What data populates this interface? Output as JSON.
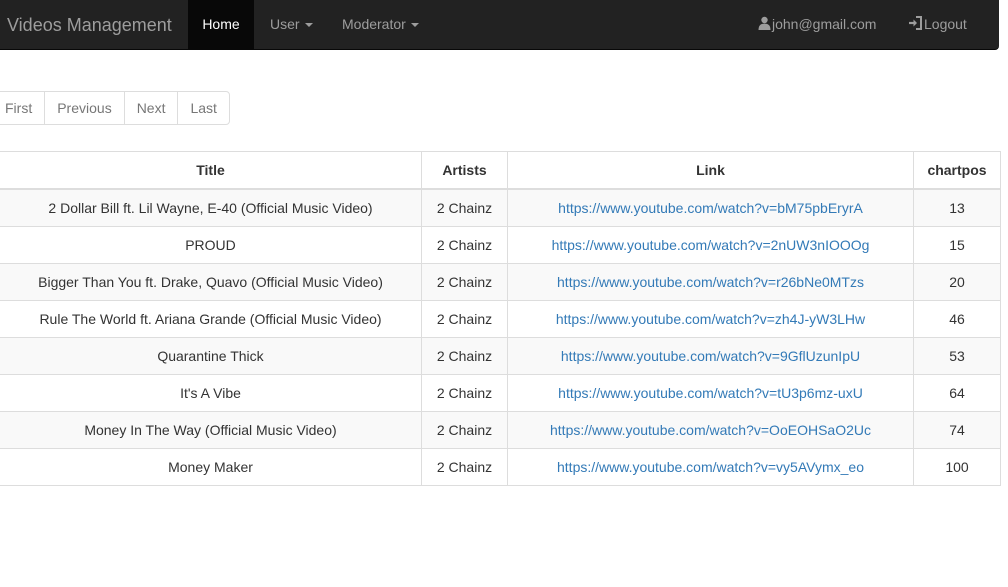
{
  "navbar": {
    "brand": "Videos Management",
    "items": [
      {
        "label": "Home"
      },
      {
        "label": "User"
      },
      {
        "label": "Moderator"
      }
    ],
    "user_email": "john@gmail.com",
    "logout_label": "Logout"
  },
  "pagination": [
    "First",
    "Previous",
    "Next",
    "Last"
  ],
  "table": {
    "headers": [
      "Title",
      "Artists",
      "Link",
      "chartpos"
    ],
    "rows": [
      [
        "2 Dollar Bill ft. Lil Wayne, E-40 (Official Music Video)",
        "2 Chainz",
        "https://www.youtube.com/watch?v=bM75pbEryrA",
        "13"
      ],
      [
        "PROUD",
        "2 Chainz",
        "https://www.youtube.com/watch?v=2nUW3nIOOOg",
        "15"
      ],
      [
        "Bigger Than You ft. Drake, Quavo (Official Music Video)",
        "2 Chainz",
        "https://www.youtube.com/watch?v=r26bNe0MTzs",
        "20"
      ],
      [
        "Rule The World ft. Ariana Grande (Official Music Video)",
        "2 Chainz",
        "https://www.youtube.com/watch?v=zh4J-yW3LHw",
        "46"
      ],
      [
        "Quarantine Thick",
        "2 Chainz",
        "https://www.youtube.com/watch?v=9GflUzunIpU",
        "53"
      ],
      [
        "It's A Vibe",
        "2 Chainz",
        "https://www.youtube.com/watch?v=tU3p6mz-uxU",
        "64"
      ],
      [
        "Money In The Way (Official Music Video)",
        "2 Chainz",
        "https://www.youtube.com/watch?v=OoEOHSaO2Uc",
        "74"
      ],
      [
        "Money Maker",
        "2 Chainz",
        "https://www.youtube.com/watch?v=vy5AVymx_eo",
        "100"
      ]
    ]
  },
  "colors": {
    "navbar": "#222222",
    "link": "#337ab7",
    "stripe": "#f9f9f9"
  },
  "icons": {
    "user": "user-icon",
    "logout": "log-in-icon"
  }
}
